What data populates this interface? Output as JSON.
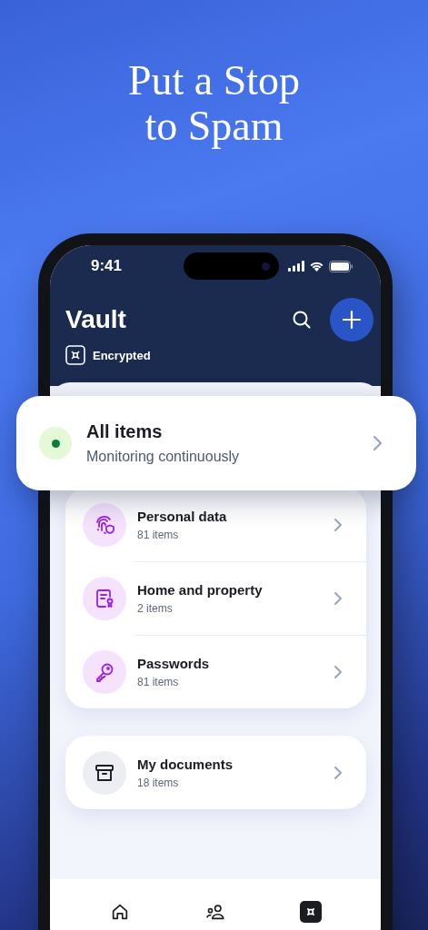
{
  "headline": "Put a Stop to Spam",
  "status_bar": {
    "time": "9:41"
  },
  "header": {
    "title": "Vault",
    "badge": "Encrypted"
  },
  "all_items": {
    "title": "All items",
    "subtitle": "Monitoring continuously"
  },
  "categories": [
    {
      "title": "Personal data",
      "count": "81 items"
    },
    {
      "title": "Home and property",
      "count": "2 items"
    },
    {
      "title": "Passwords",
      "count": "81 items"
    }
  ],
  "documents": {
    "title": "My documents",
    "count": "18 items"
  },
  "tab_bar": [
    {
      "selected": false
    },
    {
      "selected": false
    },
    {
      "selected": true
    }
  ]
}
